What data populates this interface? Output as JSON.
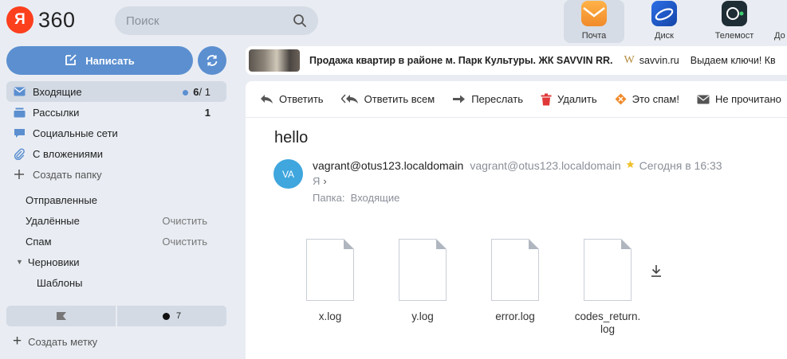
{
  "brand": {
    "ya": "Я",
    "name": "360",
    "ya_color": "#fc3f1d"
  },
  "search": {
    "placeholder": "Поиск"
  },
  "services": [
    {
      "label": "Почта",
      "icon": "mail-envelope-icon",
      "active": true
    },
    {
      "label": "Диск",
      "icon": "disk-icon",
      "active": false
    },
    {
      "label": "Телемост",
      "icon": "telemost-camera-icon",
      "active": false
    },
    {
      "label": "До",
      "icon": "docs-icon",
      "active": false
    }
  ],
  "compose": {
    "label": "Написать"
  },
  "folders": [
    {
      "label": "Входящие",
      "icon": "inbox-icon",
      "unread": "6",
      "total": "/ 1",
      "selected": true
    },
    {
      "label": "Рассылки",
      "icon": "newsletters-icon",
      "count": "1"
    },
    {
      "label": "Социальные сети",
      "icon": "social-icon"
    },
    {
      "label": "С вложениями",
      "icon": "paperclip-icon"
    },
    {
      "label": "Создать папку",
      "icon": "plus-icon"
    }
  ],
  "system_folders": [
    {
      "label": "Отправленные"
    },
    {
      "label": "Удалённые",
      "action": "Очистить"
    },
    {
      "label": "Спам",
      "action": "Очистить"
    },
    {
      "label": "Черновики"
    },
    {
      "label": "Шаблоны"
    }
  ],
  "labels": {
    "important_count": "7"
  },
  "create_label": "Создать метку",
  "ad": {
    "title": "Продажа квартир в районе м. Парк Культуры. ЖК SAVVIN RR.",
    "logo": "W",
    "domain": "savvin.ru",
    "text": "Выдаем ключи! Кв"
  },
  "toolbar": {
    "reply": "Ответить",
    "reply_all": "Ответить всем",
    "forward": "Переслать",
    "delete": "Удалить",
    "spam": "Это спам!",
    "unread": "Не прочитано"
  },
  "message": {
    "subject": "hello",
    "avatar_initials": "VA",
    "sender_name": "vagrant@otus123.localdomain",
    "sender_email": "vagrant@otus123.localdomain",
    "date": "Сегодня в 16:33",
    "to": "Я",
    "folder_label": "Папка:",
    "folder_name": "Входящие"
  },
  "attachments": [
    {
      "name": "x.log"
    },
    {
      "name": "y.log"
    },
    {
      "name": "error.log"
    },
    {
      "name": "codes_return.log",
      "line1": "codes_return.",
      "line2": "log"
    }
  ],
  "colors": {
    "accent": "#5b8fd0",
    "avatar": "#3fa6de",
    "background": "#e9edf3"
  }
}
